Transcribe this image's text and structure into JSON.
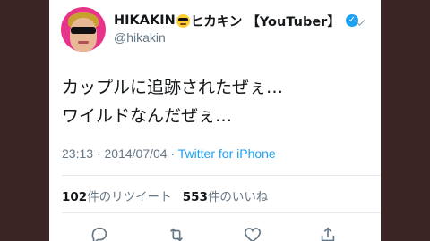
{
  "tweet": {
    "display_name": "HIKAKIN",
    "display_name_suffix": "ヒカキン 【YouTuber】",
    "handle": "@hikakin",
    "text_lines": [
      "カップルに追跡されたぜぇ…",
      "ワイルドなんだぜぇ…"
    ],
    "time": "23:13",
    "separator": "·",
    "date": "2014/07/04",
    "source": "Twitter for iPhone",
    "retweet_count": "102",
    "retweet_label": "件のリツイート",
    "like_count": "553",
    "like_label": "件のいいね"
  },
  "icons": {
    "emoji": "sunglasses-emoji-icon",
    "verified": "verified-badge-icon",
    "menu": "chevron-down-icon",
    "reply": "reply-icon",
    "retweet": "retweet-icon",
    "like": "heart-icon",
    "share": "share-icon"
  },
  "colors": {
    "background": "#3a2424",
    "card": "#ffffff",
    "avatar_bg": "#e8338a",
    "link": "#1da1f2",
    "muted": "#657786",
    "text": "#14171a",
    "verified": "#1da1f2"
  }
}
